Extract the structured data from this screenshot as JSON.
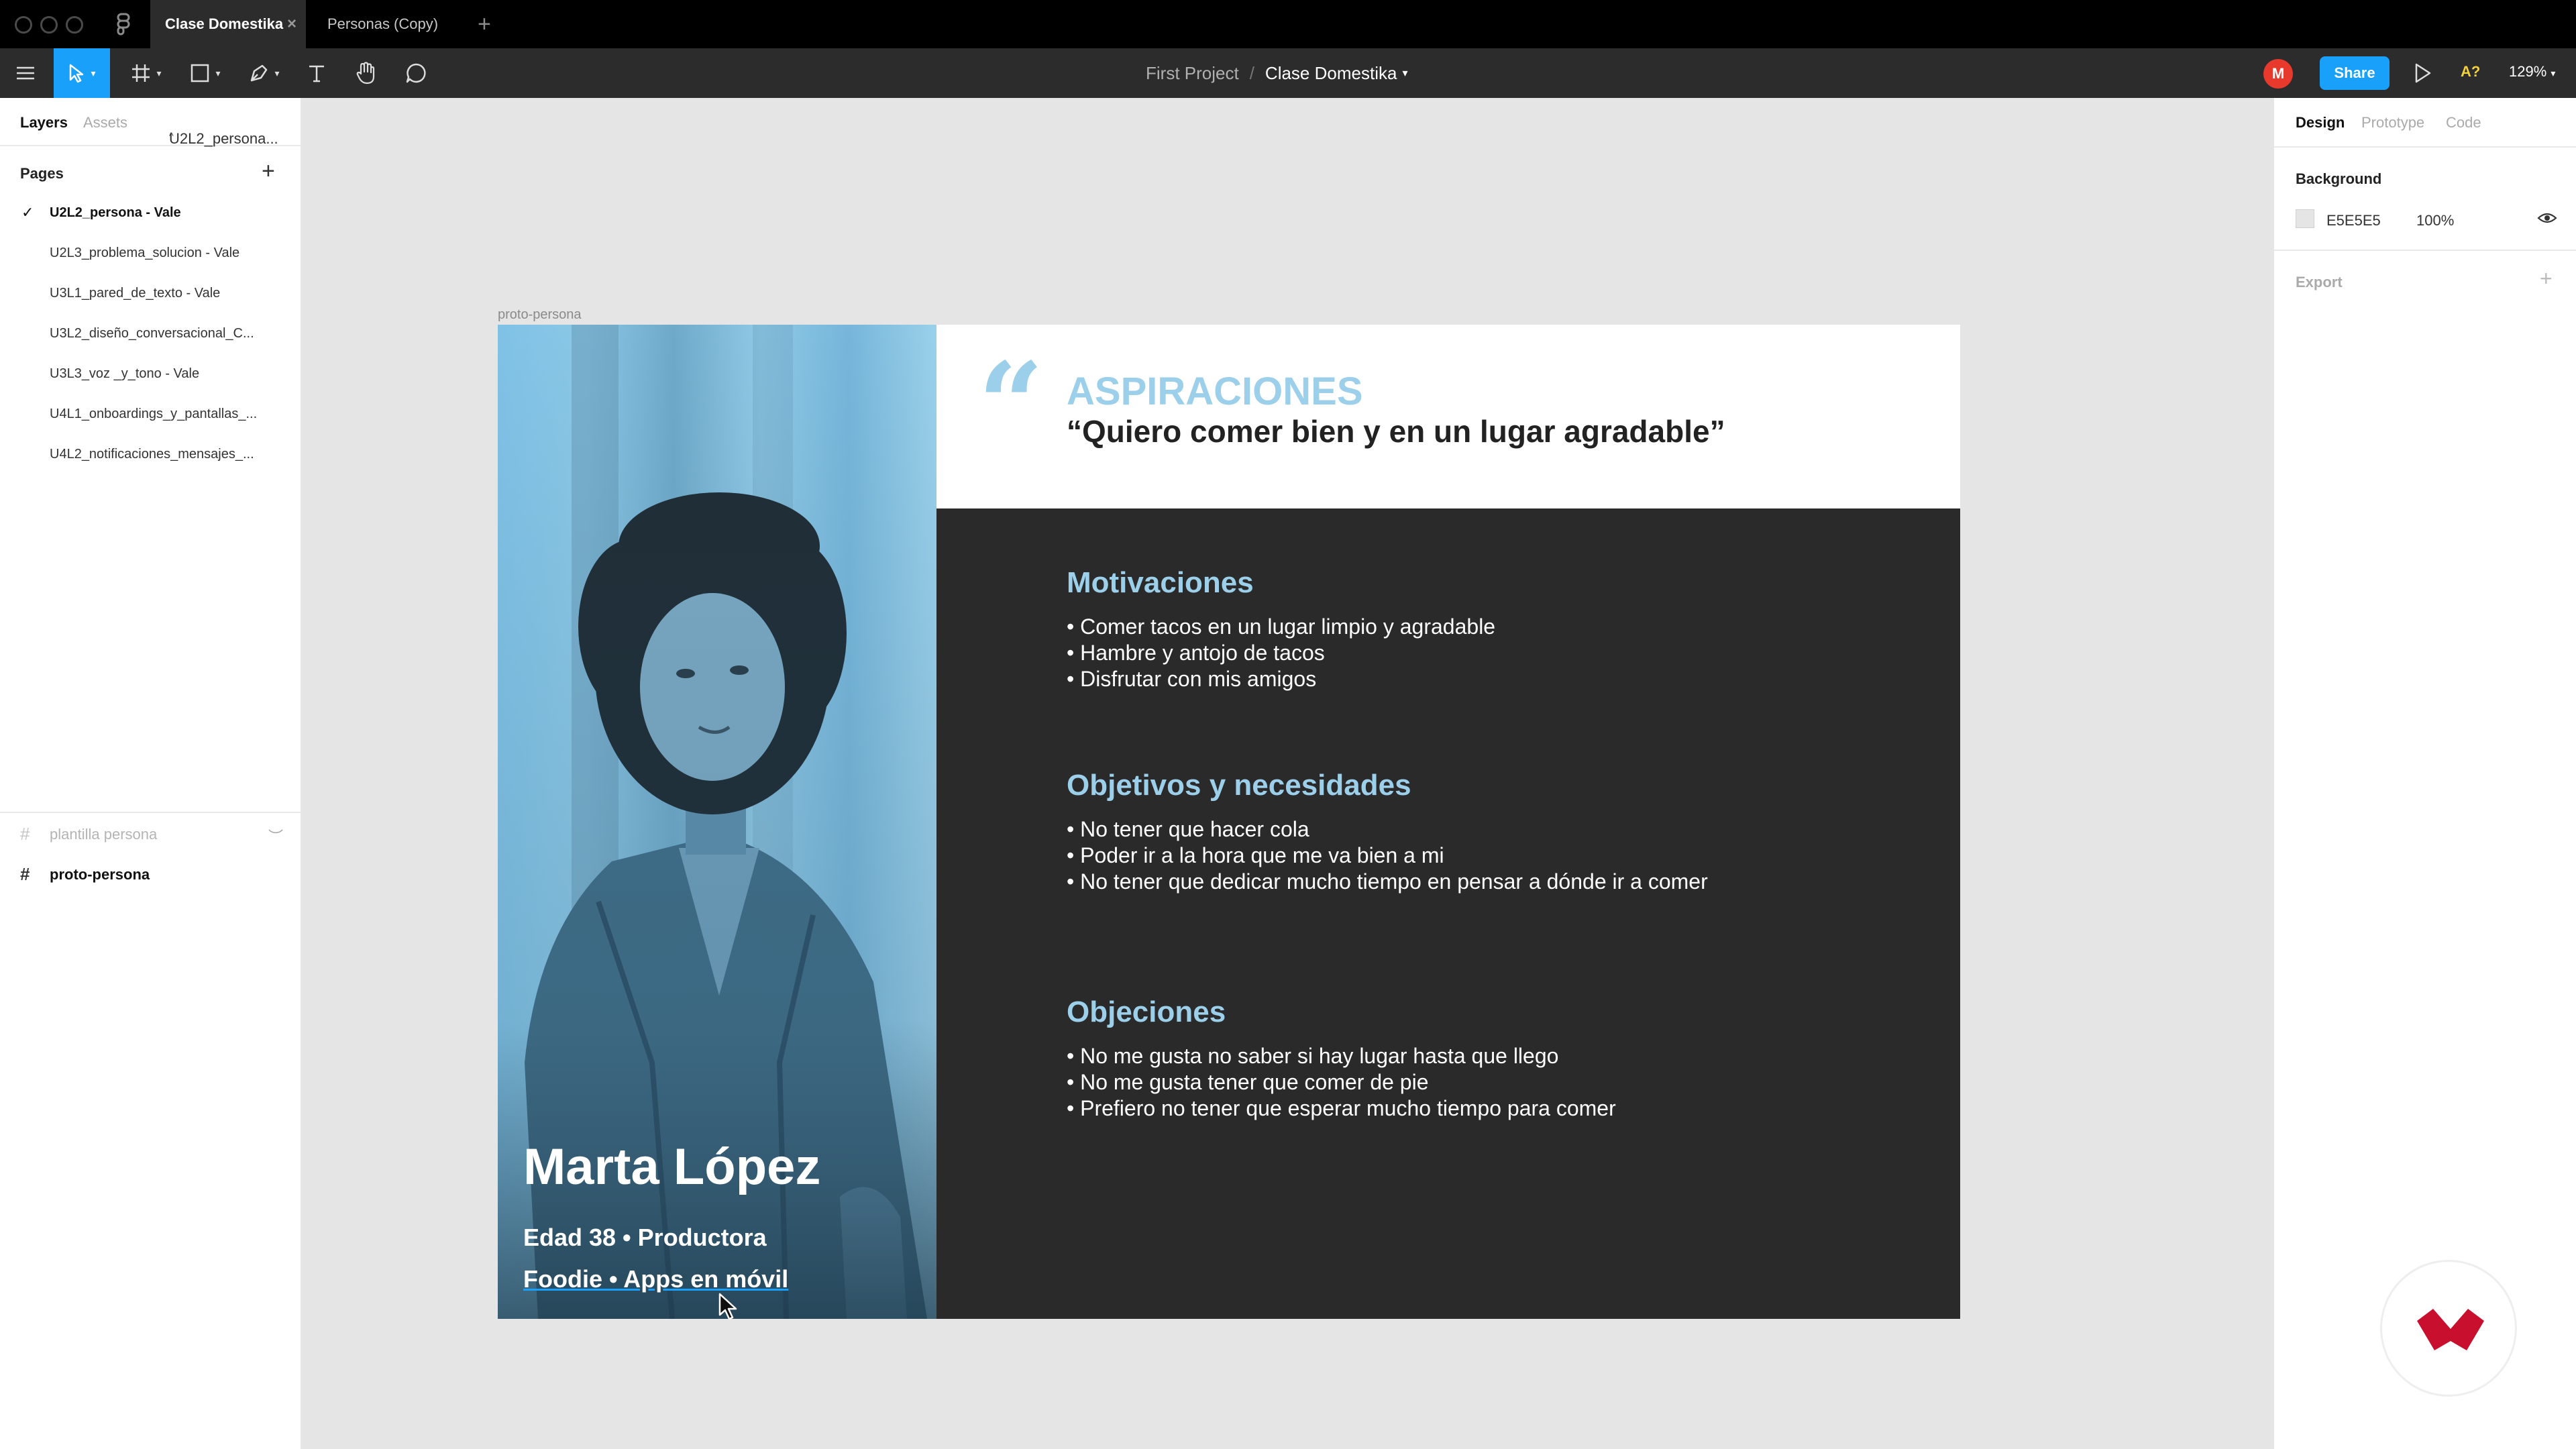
{
  "window": {
    "tabs": [
      {
        "label": "Clase Domestika",
        "active": true
      },
      {
        "label": "Personas (Copy)",
        "active": false
      }
    ]
  },
  "toolbar": {
    "project": "First Project",
    "separator": "/",
    "file": "Clase Domestika",
    "avatar_initial": "M",
    "share_label": "Share",
    "a11y_label": "A?",
    "zoom": "129%"
  },
  "left_panel": {
    "tabs": [
      "Layers",
      "Assets"
    ],
    "current_page_short": "U2L2_persona...",
    "pages_heading": "Pages",
    "pages": [
      {
        "label": "U2L2_persona - Vale",
        "current": true
      },
      {
        "label": "U2L3_problema_solucion - Vale",
        "current": false
      },
      {
        "label": "U3L1_pared_de_texto - Vale",
        "current": false
      },
      {
        "label": "U3L2_diseño_conversacional_C...",
        "current": false
      },
      {
        "label": "U3L3_voz _y_tono - Vale",
        "current": false
      },
      {
        "label": "U4L1_onboardings_y_pantallas_...",
        "current": false
      },
      {
        "label": "U4L2_notificaciones_mensajes_...",
        "current": false
      }
    ],
    "layers": [
      {
        "label": "plantilla persona",
        "hidden": true
      },
      {
        "label": "proto-persona",
        "hidden": false
      }
    ]
  },
  "right_panel": {
    "tabs": [
      "Design",
      "Prototype",
      "Code"
    ],
    "background_heading": "Background",
    "background_hex": "E5E5E5",
    "background_opacity": "100%",
    "export_heading": "Export"
  },
  "frame": {
    "label": "proto-persona",
    "persona": {
      "name": "Marta López",
      "line1": "Edad 38 • Productora",
      "line2": "Foodie • Apps en móvil"
    },
    "quote_mark": "“",
    "aspirations_title": "ASPIRACIONES",
    "aspirations_quote": "“Quiero comer bien y en un lugar agradable”",
    "sections": [
      {
        "title": "Motivaciones",
        "items": [
          "• Comer tacos en un lugar limpio y agradable",
          "• Hambre y antojo de tacos",
          "• Disfrutar con mis amigos"
        ]
      },
      {
        "title": "Objetivos y necesidades",
        "items": [
          "• No tener que hacer cola",
          "• Poder ir a la hora que me va bien a mi",
          "• No tener que dedicar mucho tiempo en pensar a dónde ir a comer"
        ]
      },
      {
        "title": "Objeciones",
        "items": [
          "• No me gusta no saber si hay lugar hasta que llego",
          "• No me gusta tener que comer de pie",
          "• Prefiero no tener que esperar mucho tiempo para comer"
        ]
      }
    ]
  },
  "colors": {
    "accent": "#18a0fb",
    "persona_blue": "#9ccfe9",
    "dark_panel": "#2a2a2b",
    "canvas": "#e5e5e5",
    "domestika_red": "#c8102e"
  }
}
